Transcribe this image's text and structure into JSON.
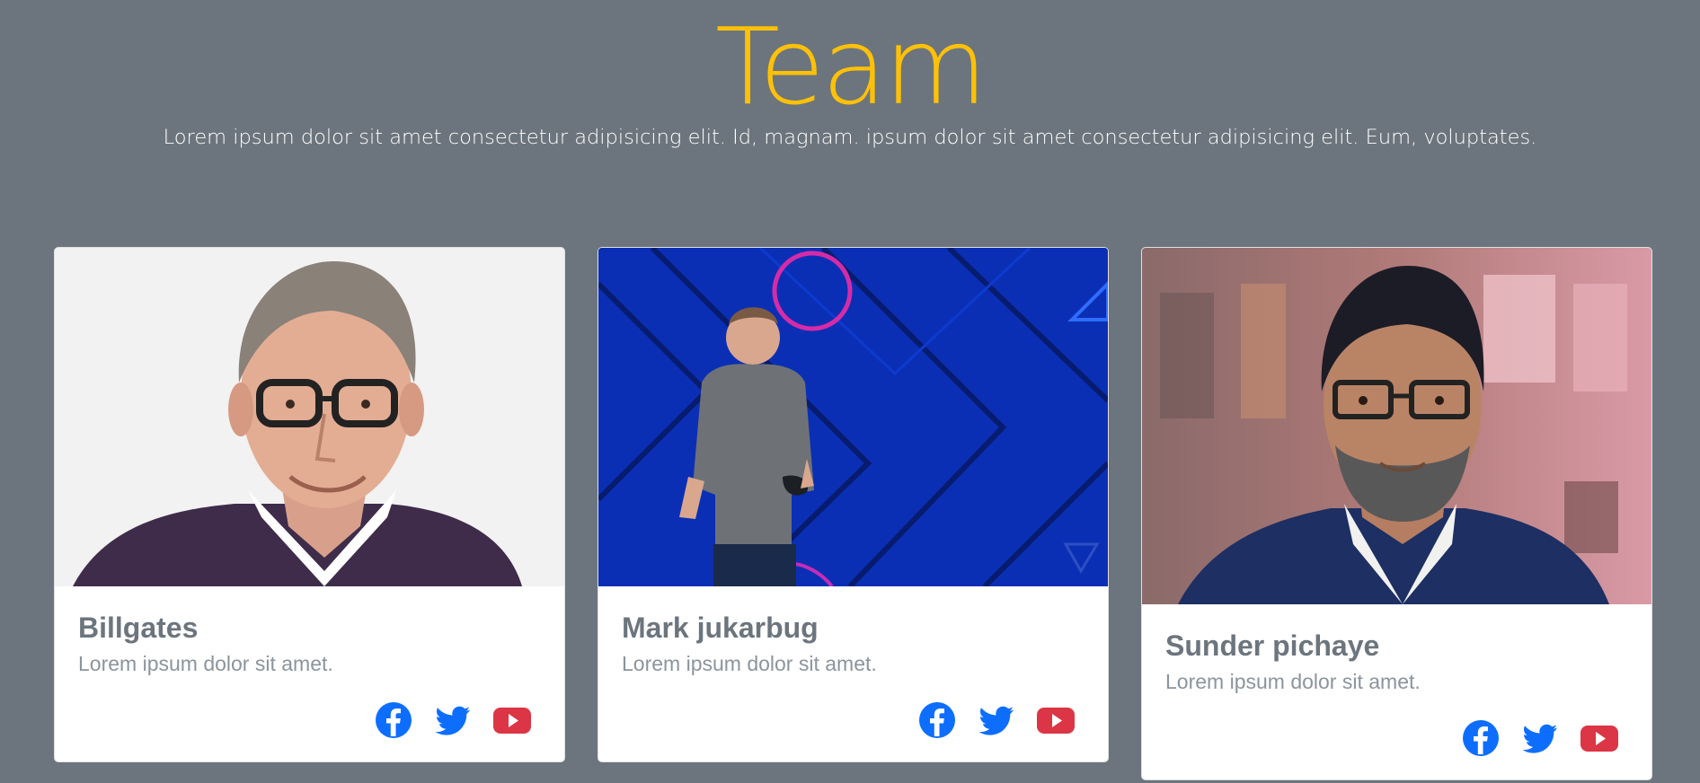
{
  "header": {
    "title": "Team",
    "subtitle": "Lorem ipsum dolor sit amet consectetur adipisicing elit. Id, magnam. ipsum dolor sit amet consectetur adipisicing elit. Eum, voluptates."
  },
  "members": [
    {
      "name": "Billgates",
      "text": "Lorem ipsum dolor sit amet."
    },
    {
      "name": "Mark jukarbug",
      "text": "Lorem ipsum dolor sit amet."
    },
    {
      "name": "Sunder pichaye",
      "text": "Lorem ipsum dolor sit amet."
    }
  ],
  "social_icons": [
    "facebook-icon",
    "twitter-icon",
    "youtube-icon"
  ],
  "colors": {
    "background": "#6c757d",
    "title": "#ffc107",
    "facebook": "#0d6efd",
    "twitter": "#0d6efd",
    "youtube": "#dc3545"
  }
}
